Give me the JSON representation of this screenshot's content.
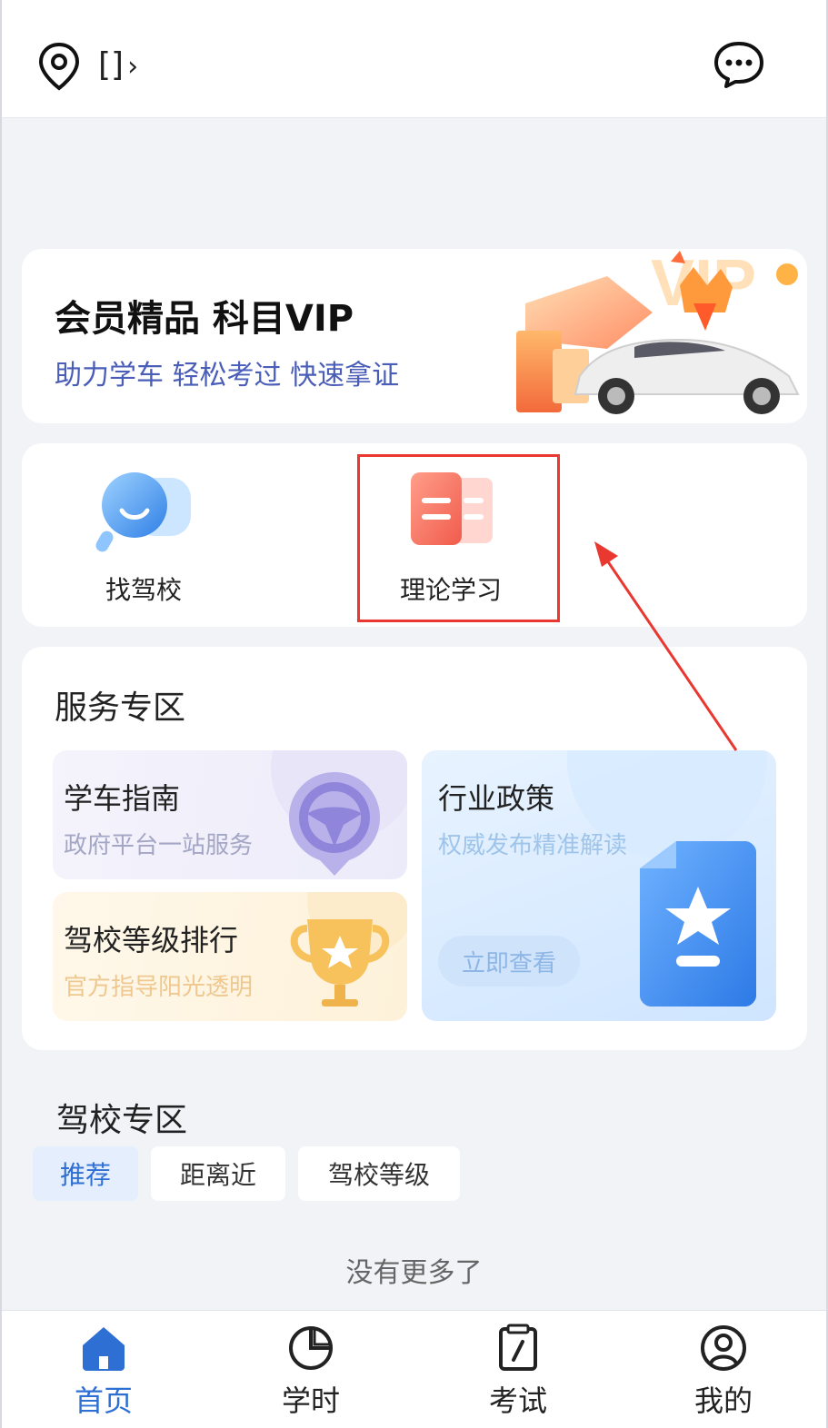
{
  "header": {
    "location_text": "[]",
    "location_chevron": "›"
  },
  "vip_banner": {
    "title": "会员精品 科目VIP",
    "subtitle": "助力学车 轻松考过 快速拿证",
    "art_text": "VIP"
  },
  "quick_entries": [
    {
      "label": "找驾校",
      "icon": "search-school-icon"
    },
    {
      "label": "理论学习",
      "icon": "book-icon"
    }
  ],
  "service_zone": {
    "title": "服务专区",
    "guide": {
      "title": "学车指南",
      "subtitle": "政府平台一站服务"
    },
    "rank": {
      "title": "驾校等级排行",
      "subtitle": "官方指导阳光透明"
    },
    "policy": {
      "title": "行业政策",
      "subtitle": "权威发布精准解读",
      "button": "立即查看"
    }
  },
  "school_zone": {
    "title": "驾校专区",
    "tabs": [
      "推荐",
      "距离近",
      "驾校等级"
    ],
    "empty_text": "没有更多了"
  },
  "bottom_nav": [
    {
      "label": "首页",
      "icon": "home-icon",
      "active": true
    },
    {
      "label": "学时",
      "icon": "pie-chart-icon",
      "active": false
    },
    {
      "label": "考试",
      "icon": "exam-icon",
      "active": false
    },
    {
      "label": "我的",
      "icon": "user-icon",
      "active": false
    }
  ],
  "colors": {
    "accent": "#2e6fd4",
    "highlight": "#e8382f",
    "background": "#f2f3f7"
  }
}
